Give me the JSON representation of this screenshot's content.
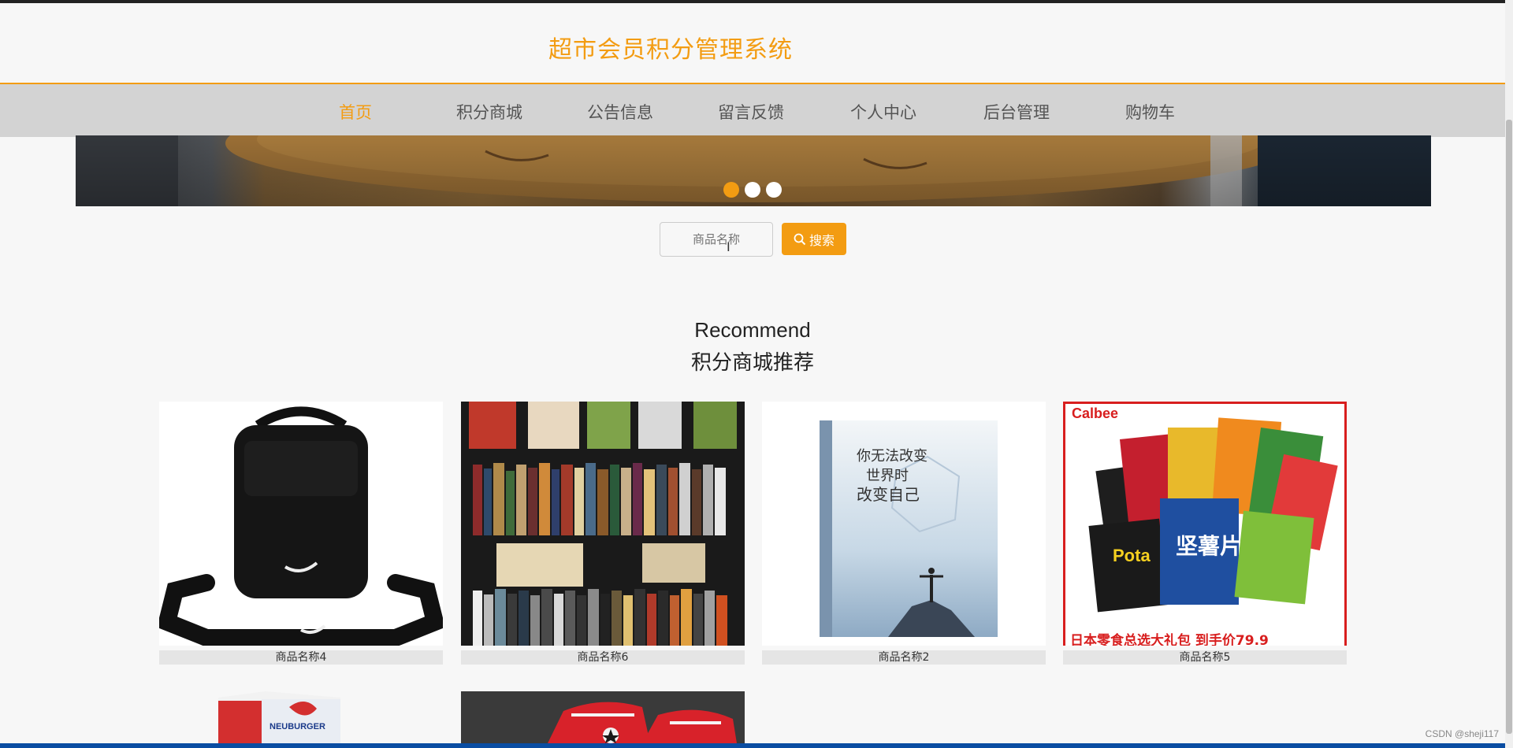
{
  "header": {
    "title": "超市会员积分管理系统"
  },
  "nav": {
    "items": [
      {
        "label": "首页",
        "active": true
      },
      {
        "label": "积分商城"
      },
      {
        "label": "公告信息"
      },
      {
        "label": "留言反馈"
      },
      {
        "label": "个人中心"
      },
      {
        "label": "后台管理"
      },
      {
        "label": "购物车"
      }
    ]
  },
  "carousel": {
    "slides": 3,
    "active_index": 0
  },
  "search": {
    "placeholder": "商品名称",
    "button_label": "搜索"
  },
  "section": {
    "title_en": "Recommend",
    "title_cn": "积分商城推荐"
  },
  "products": [
    {
      "name": "商品名称4",
      "image": "black-shoulder-bag"
    },
    {
      "name": "商品名称6",
      "image": "bookshelf"
    },
    {
      "name": "商品名称2",
      "image": "book-cover"
    },
    {
      "name": "商品名称5",
      "image": "calbee-snacks"
    },
    {
      "name": "",
      "image": "milk-carton"
    },
    {
      "name": "",
      "image": "red-sneakers"
    }
  ],
  "product_image_text": {
    "book_cover_title": "你无法改变\n世界时\n改变自己",
    "snack_brand": "Calbee",
    "snack_banner": "日本零食总选大礼包 到手价79.9",
    "milk_brand": "NEUBURGER"
  },
  "footer": {
    "watermark": "CSDN @sheji117"
  },
  "colors": {
    "accent": "#f39c12",
    "nav_bg": "#d3d3d3",
    "page_bg": "#f7f7f7"
  }
}
